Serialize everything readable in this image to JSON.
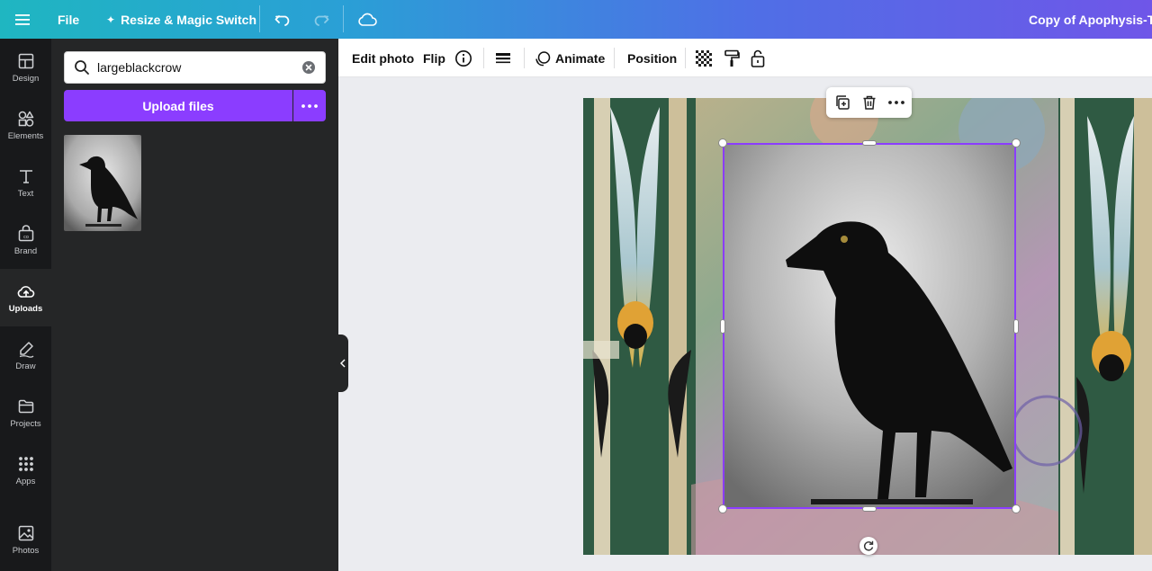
{
  "topbar": {
    "menu_icon": "hamburger-menu-icon",
    "file_label": "File",
    "resize_label": "Resize & Magic Switch",
    "document_title": "Copy of Apophysis-The"
  },
  "rail": {
    "items": [
      {
        "label": "Design",
        "icon": "design-icon"
      },
      {
        "label": "Elements",
        "icon": "elements-icon"
      },
      {
        "label": "Text",
        "icon": "text-icon"
      },
      {
        "label": "Brand",
        "icon": "brand-icon"
      },
      {
        "label": "Uploads",
        "icon": "upload-cloud-icon",
        "active": true
      },
      {
        "label": "Draw",
        "icon": "draw-icon"
      },
      {
        "label": "Projects",
        "icon": "folder-icon"
      },
      {
        "label": "Apps",
        "icon": "apps-grid-icon"
      },
      {
        "label": "Photos",
        "icon": "photos-icon"
      }
    ]
  },
  "panel": {
    "search_value": "largeblackcrow",
    "upload_label": "Upload files"
  },
  "context_toolbar": {
    "edit_photo": "Edit photo",
    "flip": "Flip",
    "animate": "Animate",
    "position": "Position"
  },
  "colors": {
    "accent": "#8b3dff",
    "selection": "#8b3dff"
  }
}
